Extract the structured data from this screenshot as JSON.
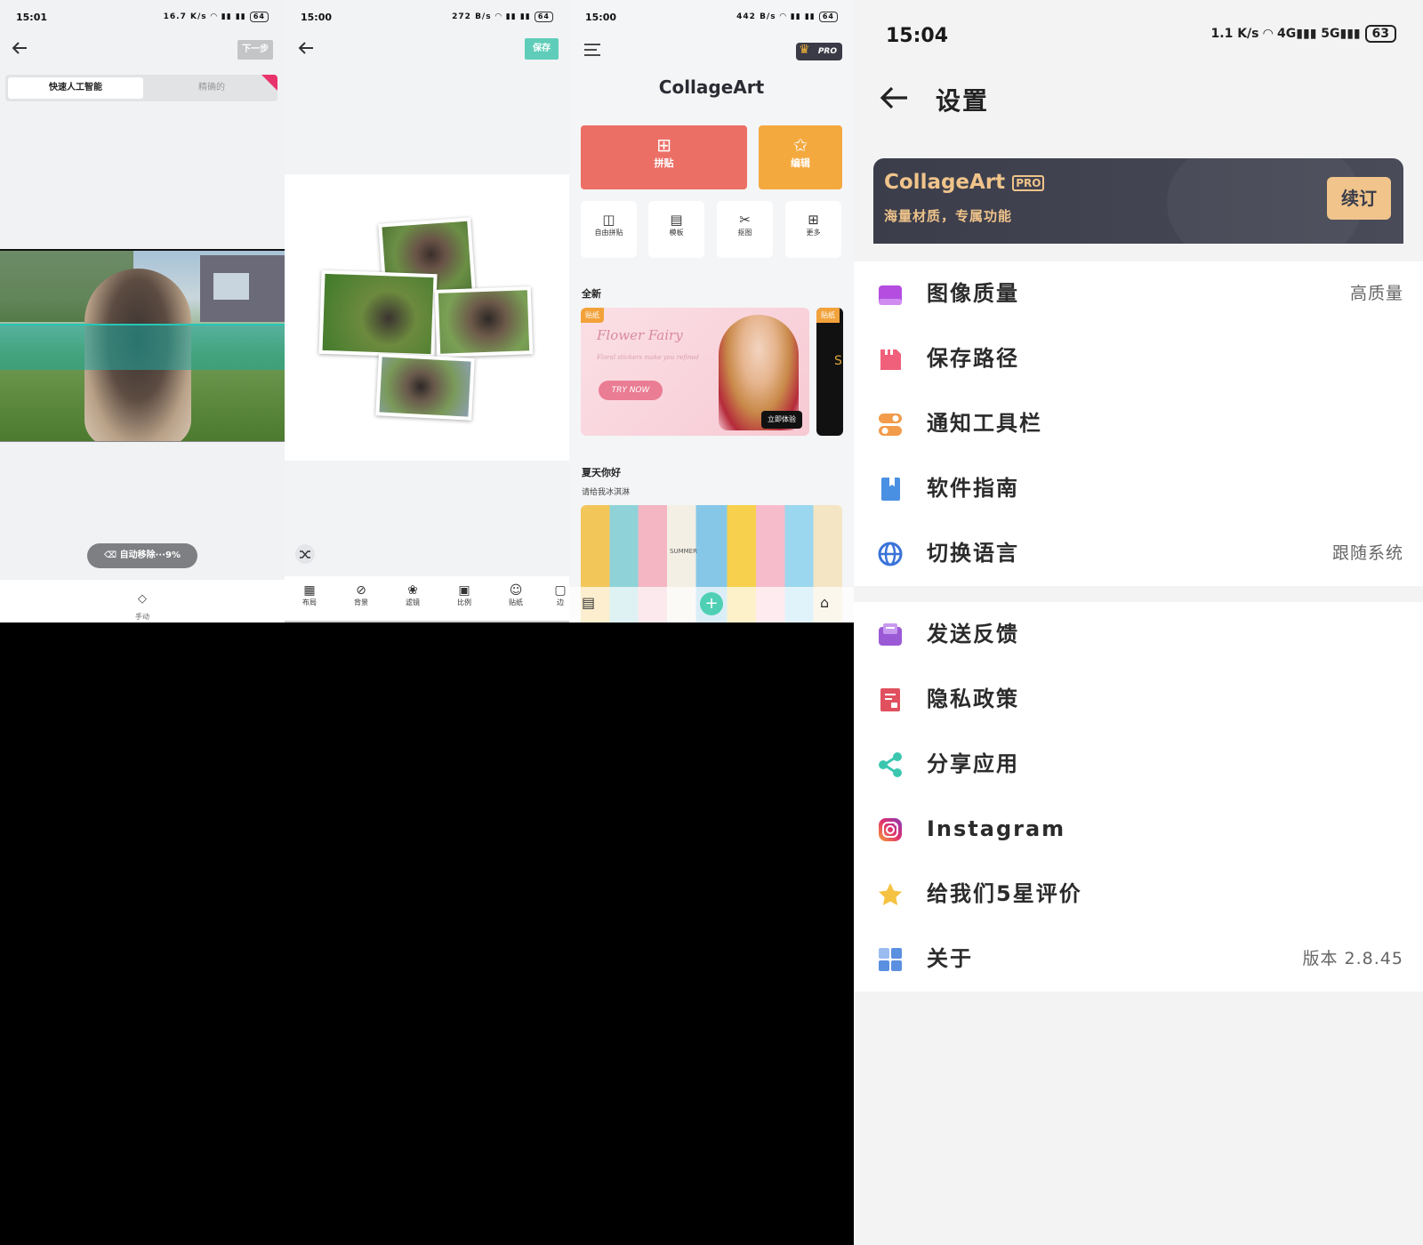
{
  "panel1": {
    "time": "15:01",
    "net_speed": "16.7 K/s",
    "battery": "64",
    "next_label": "下一步",
    "tabs": [
      "快速人工智能",
      "精确的"
    ],
    "status_pill": "自动移除···9%",
    "bottom_tool": "手动"
  },
  "panel2": {
    "time": "15:00",
    "net_speed": "272 B/s",
    "battery": "64",
    "save_label": "保存",
    "tools": [
      "布局",
      "背景",
      "滤镜",
      "比例",
      "贴纸",
      "边"
    ]
  },
  "panel3": {
    "time": "15:00",
    "net_speed": "442 B/s",
    "battery": "64",
    "pro_badge": "PRO",
    "app_title": "CollageArt",
    "big_buttons": [
      "拼贴",
      "编辑"
    ],
    "small_buttons": [
      "自由拼贴",
      "模板",
      "抠图",
      "更多"
    ],
    "section_new": "全新",
    "banner_tag": "贴纸",
    "banner_title": "Flower Fairy",
    "banner_sub": "Floral stickers make you refined",
    "banner_cta": "TRY NOW",
    "banner_action": "立即体验",
    "banner2_letter": "S",
    "section2_title": "夏天你好",
    "section2_sub": "请给我冰淇淋",
    "summer_text": "SUMMER"
  },
  "panel4": {
    "time": "15:04",
    "net_speed": "1.1 K/s",
    "battery": "63",
    "title": "设置",
    "pro_title": "CollageArt",
    "pro_badge": "PRO",
    "pro_sub": "海量材质，专属功能",
    "renew": "续订",
    "group1": [
      {
        "icon": "image-quality-icon",
        "label": "图像质量",
        "value": "高质量",
        "color": "#b44de0"
      },
      {
        "icon": "save-path-icon",
        "label": "保存路径",
        "value": "",
        "color": "#f0607a"
      },
      {
        "icon": "toolbar-toggle-icon",
        "label": "通知工具栏",
        "value": "",
        "color": "#f29b4b"
      },
      {
        "icon": "guide-book-icon",
        "label": "软件指南",
        "value": "",
        "color": "#4a90e2"
      },
      {
        "icon": "globe-icon",
        "label": "切换语言",
        "value": "跟随系统",
        "color": "#3a73d8"
      }
    ],
    "group2": [
      {
        "icon": "feedback-mail-icon",
        "label": "发送反馈",
        "value": "",
        "color": "#9b59d6"
      },
      {
        "icon": "privacy-doc-icon",
        "label": "隐私政策",
        "value": "",
        "color": "#e0505e"
      },
      {
        "icon": "share-icon",
        "label": "分享应用",
        "value": "",
        "color": "#3cc6b0"
      },
      {
        "icon": "instagram-icon",
        "label": "Instagram",
        "value": "",
        "color": "#e1306c"
      },
      {
        "icon": "star-icon",
        "label": "给我们5星评价",
        "value": "",
        "color": "#f5c242"
      },
      {
        "icon": "about-grid-icon",
        "label": "关于",
        "value": "版本 2.8.45",
        "color": "#5b8fe0"
      }
    ]
  }
}
